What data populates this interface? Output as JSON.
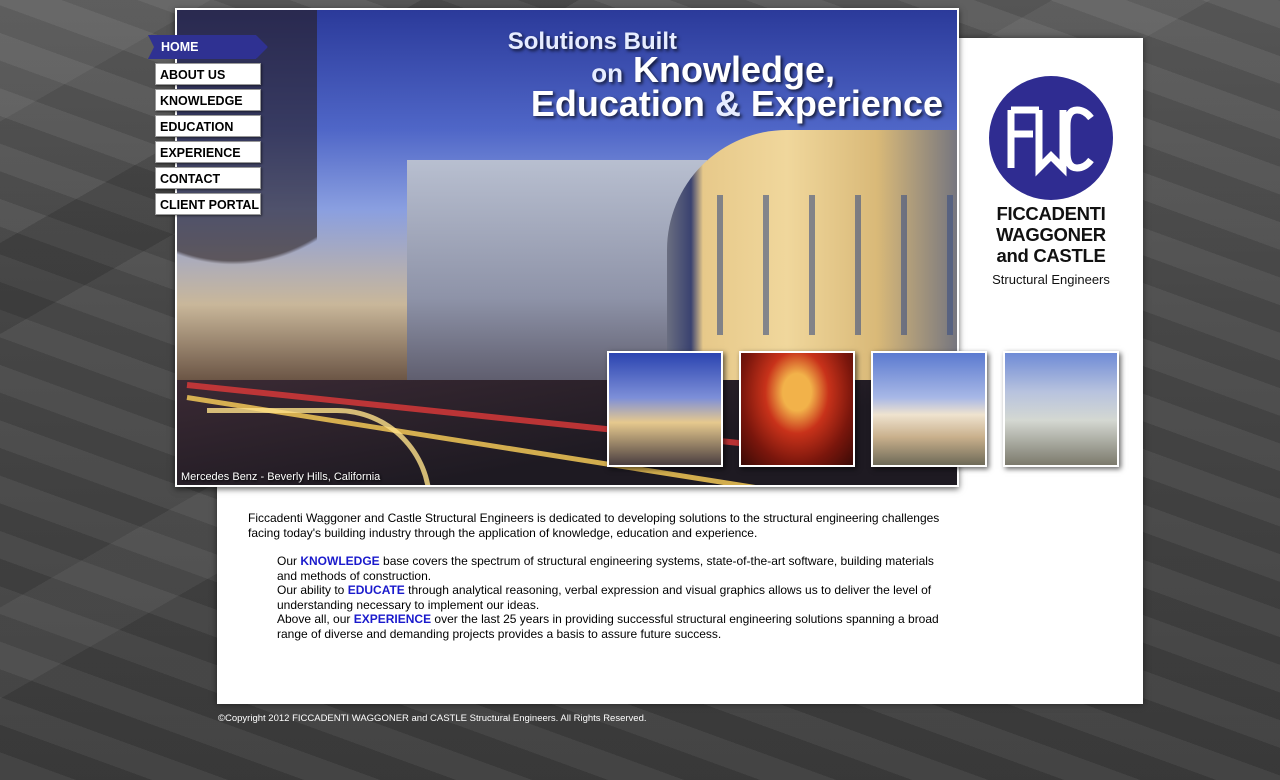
{
  "nav": {
    "items": [
      {
        "label": "HOME",
        "active": true
      },
      {
        "label": "ABOUT US"
      },
      {
        "label": "KNOWLEDGE"
      },
      {
        "label": "EDUCATION"
      },
      {
        "label": "EXPERIENCE"
      },
      {
        "label": "CONTACT"
      },
      {
        "label": "CLIENT PORTAL"
      }
    ]
  },
  "hero": {
    "title_line1": "Solutions Built",
    "title_on": "on",
    "title_line2": "Knowledge,",
    "title_line3a": "Education",
    "title_amp": "&",
    "title_line3b": "Experience",
    "caption": "Mercedes Benz - Beverly Hills, California"
  },
  "logo": {
    "monogram": "FWC",
    "name_line1": "FICCADENTI",
    "name_line2": "WAGGONER",
    "name_line3": "and CASTLE",
    "subtitle": "Structural Engineers",
    "color": "#2f2c91"
  },
  "thumbnails": [
    {
      "name": "thumb-building"
    },
    {
      "name": "thumb-theater"
    },
    {
      "name": "thumb-hotel"
    },
    {
      "name": "thumb-glass-building"
    }
  ],
  "content": {
    "intro": "Ficcadenti Waggoner and Castle Structural Engineers is dedicated to developing solutions to the structural engineering challenges facing today's building industry through the application of knowledge, education and experience.",
    "p1_pre": "Our ",
    "p1_kw": "KNOWLEDGE",
    "p1_post": " base covers the spectrum of structural engineering systems, state-of-the-art software, building materials and methods of construction.",
    "p2_pre": "Our ability to ",
    "p2_kw": "EDUCATE",
    "p2_post": " through analytical reasoning, verbal expression and visual graphics allows us to deliver the level of understanding necessary to implement our ideas.",
    "p3_pre": "Above all, our ",
    "p3_kw": "EXPERIENCE",
    "p3_post": " over the last 25 years in providing successful structural engineering solutions spanning a broad range of diverse and demanding projects provides a basis to assure future success.",
    "keyword_color": "#1a1acc"
  },
  "footer": {
    "copyright": "©Copyright 2012 FICCADENTI WAGGONER and CASTLE Structural Engineers. All Rights Reserved."
  }
}
